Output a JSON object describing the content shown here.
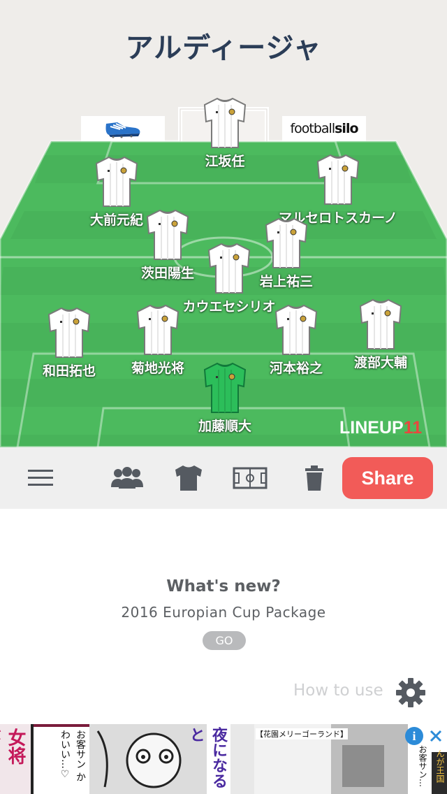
{
  "team_name": "アルディージャ",
  "sponsors": {
    "left_icon": "football-boot-icon",
    "right_brand_regular": "football",
    "right_brand_bold": "silo"
  },
  "players": [
    {
      "name": "江坂任",
      "kit": "white"
    },
    {
      "name": "大前元紀",
      "kit": "white"
    },
    {
      "name": "マルセロトスカーノ",
      "kit": "white"
    },
    {
      "name": "茨田陽生",
      "kit": "white"
    },
    {
      "name": "岩上祐三",
      "kit": "white"
    },
    {
      "name": "カウエセシリオ",
      "kit": "white"
    },
    {
      "name": "和田拓也",
      "kit": "white"
    },
    {
      "name": "菊地光将",
      "kit": "white"
    },
    {
      "name": "河本裕之",
      "kit": "white"
    },
    {
      "name": "渡部大輔",
      "kit": "white"
    },
    {
      "name": "加藤順大",
      "kit": "green"
    }
  ],
  "app_logo": {
    "text": "LINEUP",
    "number": "11"
  },
  "toolbar": {
    "menu_icon": "hamburger-menu-icon",
    "players_icon": "group-icon",
    "kit_icon": "shirt-icon",
    "field_icon": "pitch-icon",
    "delete_icon": "trash-icon",
    "share_label": "Share"
  },
  "news": {
    "heading": "What's new?",
    "subtitle": "2016 Europian Cup Package",
    "go_label": "GO"
  },
  "help": {
    "label": "How to use",
    "icon": "gear-icon"
  },
  "ad_banner": {
    "text_blocks": [
      "女将が…",
      "お客サン かわいい…♡",
      "夜になると",
      "【花園メリーゴーランド】",
      "お客サン…",
      "んが王国"
    ],
    "info_icon": "info-icon",
    "close_icon": "close-icon"
  },
  "colors": {
    "title": "#2b3d57",
    "pitch_light": "#4cba5e",
    "pitch_dark": "#43ad55",
    "share": "#f25b58",
    "keeper_kit": "#2cbe5a"
  }
}
